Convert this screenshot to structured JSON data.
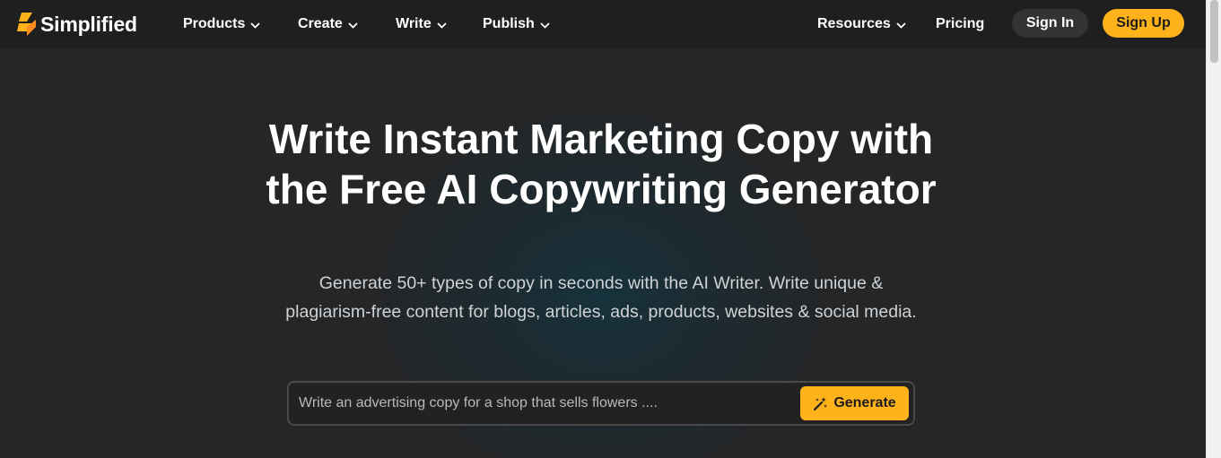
{
  "brand": {
    "name": "Simplified",
    "accent": "#ffb21a"
  },
  "nav": {
    "products": "Products",
    "create": "Create",
    "write": "Write",
    "publish": "Publish",
    "resources": "Resources",
    "pricing": "Pricing",
    "sign_in": "Sign In",
    "sign_up": "Sign Up"
  },
  "hero": {
    "title": "Write Instant Marketing Copy with the Free AI Copywriting Generator",
    "subtitle": "Generate 50+ types of copy in seconds with the AI Writer. Write unique & plagiarism-free content for blogs, articles, ads, products, websites & social media.",
    "prompt_placeholder": "Write an advertising copy for a shop that sells flowers ....",
    "prompt_value": "",
    "generate_label": "Generate"
  },
  "icons": {
    "logo": "simplified-logo-icon",
    "dropdown": "chevron-down-icon",
    "generate": "magic-wand-icon"
  }
}
